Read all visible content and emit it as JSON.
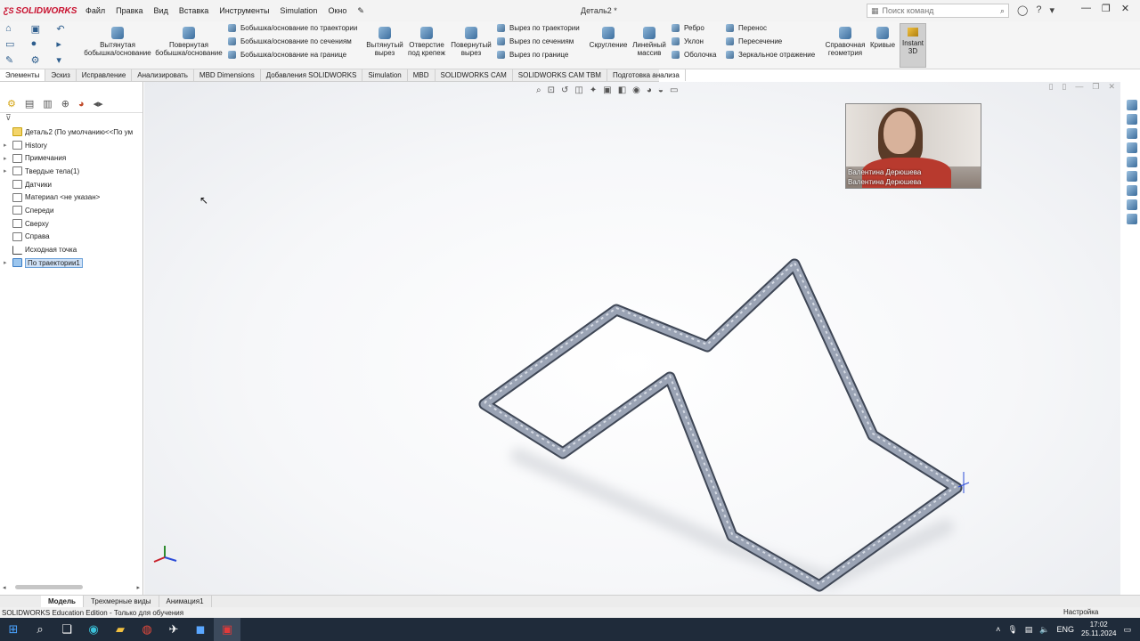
{
  "app": {
    "logo_text": "SOLIDWORKS",
    "menu": [
      "Файл",
      "Правка",
      "Вид",
      "Вставка",
      "Инструменты",
      "Simulation",
      "Окно"
    ],
    "document_title": "Деталь2 *",
    "search_placeholder": "Поиск команд"
  },
  "ribbon": {
    "extruded_boss": "Вытянутая бобышка/основание",
    "revolved_boss": "Повернутая бобышка/основание",
    "swept_boss": "Бобышка/основание по траектории",
    "lofted_boss": "Бобышка/основание по сечениям",
    "boundary_boss": "Бобышка/основание на границе",
    "extruded_cut": "Вытянутый вырез",
    "hole_wizard": "Отверстие под крепеж",
    "revolved_cut": "Повернутый вырез",
    "swept_cut": "Вырез по траектории",
    "lofted_cut": "Вырез по сечениям",
    "boundary_cut": "Вырез по границе",
    "fillet": "Скругление",
    "linear_pattern": "Линейный массив",
    "rib": "Ребро",
    "draft": "Уклон",
    "shell": "Оболочка",
    "wrap": "Перенос",
    "intersect": "Пересечение",
    "mirror": "Зеркальное отражение",
    "ref_geometry": "Справочная геометрия",
    "curves": "Кривые",
    "instant3d": "Instant 3D"
  },
  "tabs": [
    "Элементы",
    "Эскиз",
    "Исправление",
    "Анализировать",
    "MBD Dimensions",
    "Добавления SOLIDWORKS",
    "Simulation",
    "MBD",
    "SOLIDWORKS CAM",
    "SOLIDWORKS CAM TBM",
    "Подготовка анализа"
  ],
  "feature_tree": [
    {
      "label": "Деталь2  (По умолчанию<<По ум",
      "arrow": ""
    },
    {
      "label": "History",
      "arrow": "▸"
    },
    {
      "label": "Примечания",
      "arrow": "▸"
    },
    {
      "label": "Твердые тела(1)",
      "arrow": "▸"
    },
    {
      "label": "Датчики",
      "arrow": ""
    },
    {
      "label": "Материал <не указан>",
      "arrow": ""
    },
    {
      "label": "Спереди",
      "arrow": ""
    },
    {
      "label": "Сверху",
      "arrow": ""
    },
    {
      "label": "Справа",
      "arrow": ""
    },
    {
      "label": "Исходная точка",
      "arrow": ""
    },
    {
      "label": "По траектории1",
      "arrow": "▸"
    }
  ],
  "video": {
    "participant_name": "Валентина Дерюшева"
  },
  "bottom_tabs": [
    "Модель",
    "Трехмерные виды",
    "Анимация1"
  ],
  "status": {
    "edition": "SOLIDWORKS Education Edition - Только для обучения",
    "settings": "Настройка"
  },
  "taskbar": {
    "language": "ENG",
    "time": "17:02",
    "date": "25.11.2024"
  },
  "colors": {
    "brand": "#c8102e",
    "pipe": "#9aa3b4",
    "taskbar": "#1f2b3a"
  }
}
